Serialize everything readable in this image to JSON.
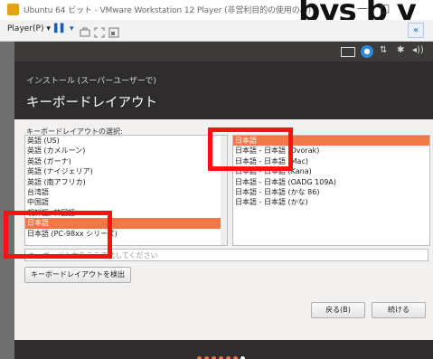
{
  "window": {
    "title": "Ubuntu 64 ビット - VMware Workstation 12 Player (非営利目的の使用のみ)",
    "minimize_glyph": "—",
    "maximize_glyph": "□",
    "overlay_text": "bys b y"
  },
  "toolbar": {
    "player_menu": "Player(P) ▾",
    "pause_glyph": "▌▌ ▾",
    "collapse_glyph": "«"
  },
  "topbar": {
    "keyboard_glyph": "",
    "network_glyph": "⇅",
    "transfer_glyph": "⇅",
    "bluetooth_glyph": "✱",
    "volume_glyph": "◂))"
  },
  "installer": {
    "window_title": "インストール (スーパーユーザーで)",
    "heading": "キーボードレイアウト",
    "select_label": "キーボードレイアウトの選択:",
    "layouts": [
      "英語 (US)",
      "英語 (カメルーン)",
      "英語 (ガーナ)",
      "英語 (ナイジェリア)",
      "英語 (南アフリカ)",
      "台湾語",
      "中国語",
      "朝鮮語; 韓国語",
      "日本語",
      "日本語 (PC-98xx シリーズ)"
    ],
    "selected_layout": "日本語",
    "variants": [
      "日本語",
      "日本語 - 日本語 (Dvorak)",
      "日本語 - 日本語 (Mac)",
      "日本語 - 日本語 (Kana)",
      "日本語 - 日本語 (OADG 109A)",
      "日本語 - 日本語 (かな 86)",
      "日本語 - 日本語 (かな)"
    ],
    "selected_variant": "日本語",
    "test_placeholder": "キーボード入力をここで試してください",
    "detect_button": "キーボードレイアウトを検出",
    "back_button": "戻る(B)",
    "continue_button": "続ける",
    "progress": {
      "total": 7,
      "current": 6
    }
  },
  "colors": {
    "accent": "#f07746",
    "highlight": "#ff1010",
    "guest_bg": "#2e2c2c"
  }
}
